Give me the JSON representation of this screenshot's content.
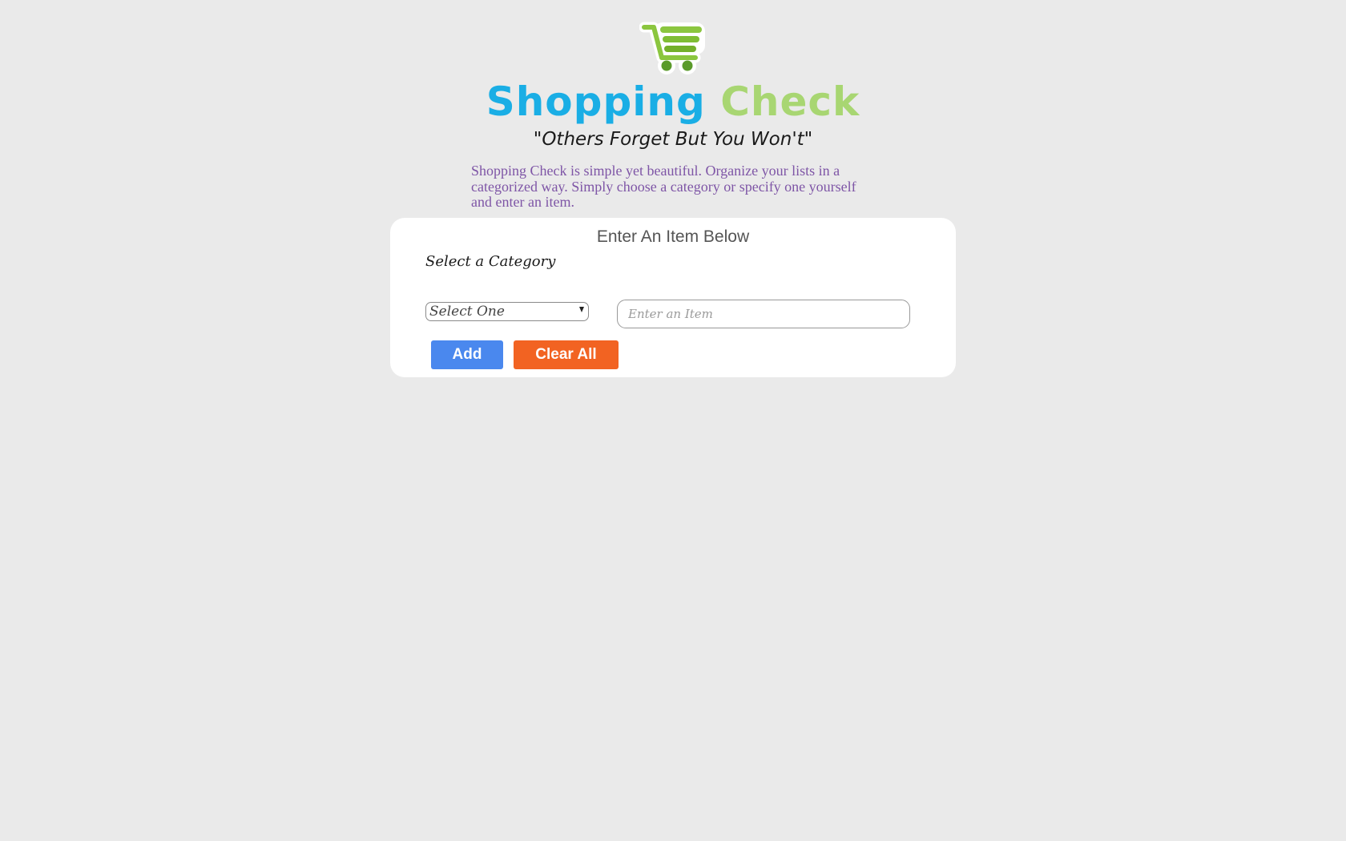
{
  "header": {
    "brand_part1": "Shopping",
    "brand_part2": "Check",
    "tagline": "\"Others Forget But You Won't\"",
    "description": "Shopping Check is simple yet beautiful. Organize your lists in a categorized way. Simply choose a category or specify one yourself and enter an item.",
    "logo_icon": "shopping-cart-icon"
  },
  "form": {
    "title": "Enter An Item Below",
    "category_label": "Select a Category",
    "category_selected": "Select One",
    "item_placeholder": "Enter an Item",
    "item_value": "",
    "add_label": "Add",
    "clear_label": "Clear All"
  },
  "colors": {
    "background": "#eaeaea",
    "brand_blue": "#1aaee5",
    "brand_green": "#a8d672",
    "description_purple": "#7e55a6",
    "add_button": "#4a88ee",
    "clear_button": "#f26322",
    "card": "#ffffff"
  }
}
